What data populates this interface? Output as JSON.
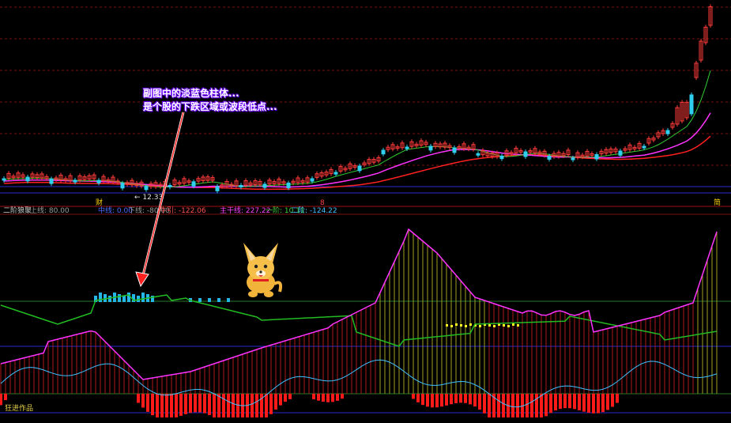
{
  "annotation": {
    "line1": "副图中的淡蓝色柱体...",
    "line2": "是个股的下跌区域或波段低点..."
  },
  "markers": {
    "cai": "财",
    "red_dot": "8",
    "right_tag": "简",
    "ma_label": "← 12.33"
  },
  "indicator_title": {
    "name": "二阶狼聚",
    "items": [
      {
        "label": "上线: 80.00",
        "color": "#9a9a9a"
      },
      {
        "label": "中线: 0.00",
        "color": "#4a6cff"
      },
      {
        "label": "下线: -80.00",
        "color": "#9a9a9a"
      },
      {
        "label": "牛引: -122.06",
        "color": "#ff5050"
      },
      {
        "label": "主干线: 227.22",
        "color": "#ff40ff"
      },
      {
        "label": "一阶: 10.11",
        "color": "#3cd23c"
      },
      {
        "label": "二阶: -124.22",
        "color": "#40c0ff"
      }
    ]
  },
  "credit": "狂进作品",
  "colors": {
    "up": "#ff3a3a",
    "down": "#2fd0ef",
    "ma_red": "#ff2020",
    "ma_magenta": "#ff33ff",
    "ma_green": "#33cc33",
    "signal_bar": "#25b6e8",
    "main_line": "#ff33ff",
    "first_order": "#22bb22",
    "second_order": "#40c0ff",
    "yellow": "#ffff22"
  },
  "chart_data": [
    {
      "type": "candlestick",
      "panel": "main",
      "candles_sample": [
        {
          "i": 0,
          "o": 0.0,
          "c": 0.5
        }
      ]
    },
    {
      "type": "line",
      "panel": "indicator",
      "series_names": [
        "主干线",
        "一阶",
        "二阶",
        "牛引"
      ],
      "levels": {
        "上线": 80,
        "中线": 0,
        "下线": -80
      }
    }
  ]
}
